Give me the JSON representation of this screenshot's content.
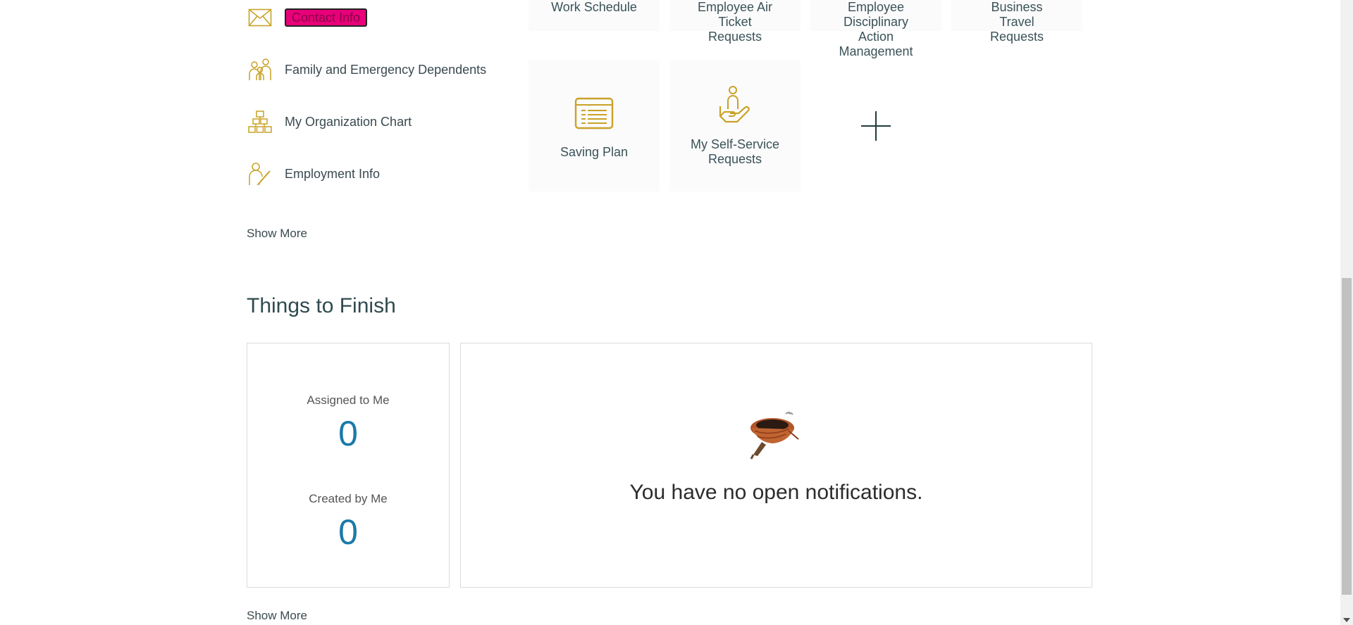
{
  "quick_actions": {
    "items": [
      {
        "label": "Contact Info",
        "icon": "envelope-icon",
        "highlighted": true
      },
      {
        "label": "Family and Emergency Dependents",
        "icon": "family-icon"
      },
      {
        "label": "My Organization Chart",
        "icon": "org-chart-icon"
      },
      {
        "label": "Employment Info",
        "icon": "employee-edit-icon"
      }
    ],
    "show_more": "Show More"
  },
  "apps": {
    "tiles": [
      {
        "label": "Work Schedule"
      },
      {
        "label": "Employee Air Ticket Requests"
      },
      {
        "label": "Employee Disciplinary Action Management"
      },
      {
        "label": "Business Travel Requests"
      },
      {
        "label": "Saving Plan",
        "icon": "document-list-icon"
      },
      {
        "label": "My Self-Service Requests",
        "icon": "person-in-hand-icon"
      }
    ],
    "add_icon": "plus-icon"
  },
  "things_to_finish": {
    "title": "Things to Finish",
    "assigned_label": "Assigned to Me",
    "assigned_value": "0",
    "created_label": "Created by Me",
    "created_value": "0",
    "empty_message": "You have no open notifications.",
    "show_more": "Show More"
  },
  "colors": {
    "icon_gold": "#c9a227",
    "accent_blue": "#1a7aa8",
    "highlight": "#e8007a"
  }
}
